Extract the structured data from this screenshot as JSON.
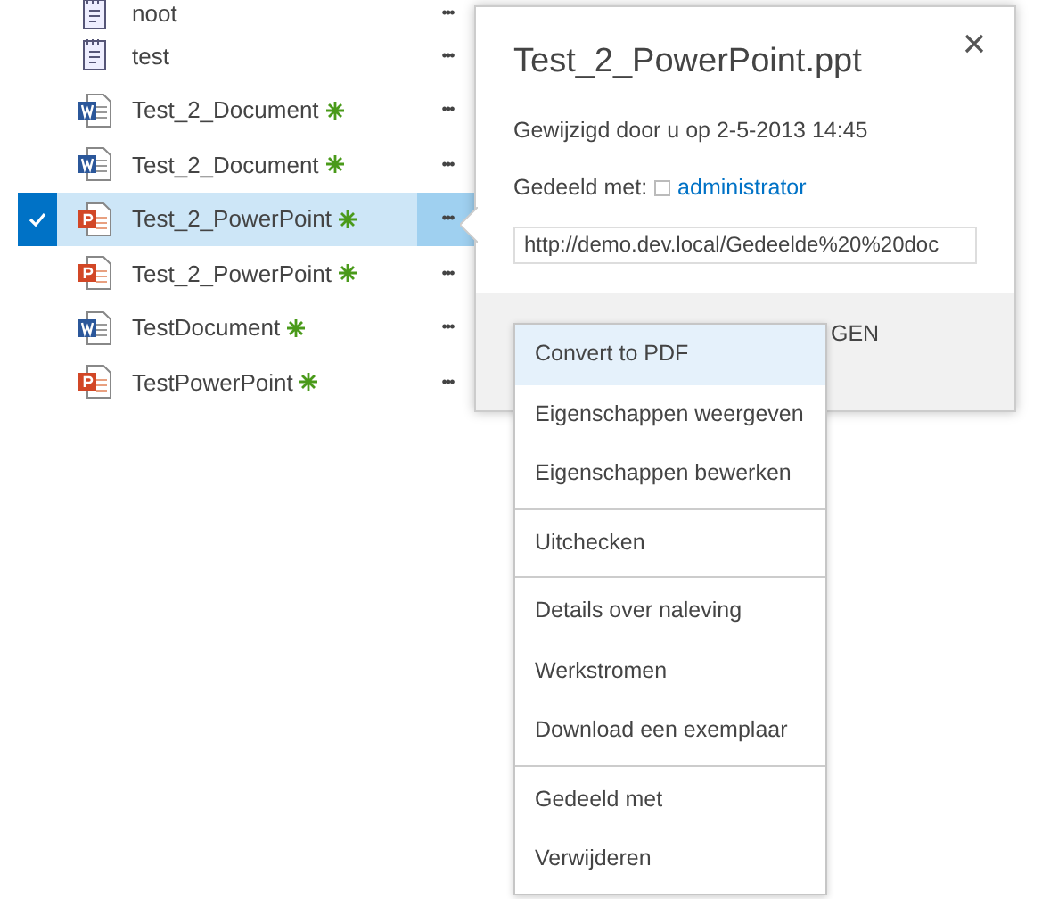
{
  "files": [
    {
      "name": "noot",
      "kind": "text",
      "new": false,
      "selected": false
    },
    {
      "name": "test",
      "kind": "text",
      "new": false,
      "selected": false
    },
    {
      "name": "Test_2_Document",
      "kind": "word",
      "new": true,
      "selected": false
    },
    {
      "name": "Test_2_Document",
      "kind": "word",
      "new": true,
      "selected": false
    },
    {
      "name": "Test_2_PowerPoint",
      "kind": "powerpoint",
      "new": true,
      "selected": true
    },
    {
      "name": "Test_2_PowerPoint",
      "kind": "powerpoint",
      "new": true,
      "selected": false
    },
    {
      "name": "TestDocument",
      "kind": "word",
      "new": true,
      "selected": false
    },
    {
      "name": "TestPowerPoint",
      "kind": "powerpoint",
      "new": true,
      "selected": false
    }
  ],
  "ellipsis": "•••",
  "callout": {
    "title": "Test_2_PowerPoint.ppt",
    "modified": "Gewijzigd door u op 2-5-2013 14:45",
    "shared_label": "Gedeeld met:",
    "shared_with": "administrator",
    "url": "http://demo.dev.local/Gedeelde%20%20doc",
    "footer_action": "GEN"
  },
  "menu": {
    "groups": [
      [
        {
          "label": "Convert to PDF",
          "selected": true
        },
        {
          "label": "Eigenschappen weergeven",
          "selected": false
        },
        {
          "label": "Eigenschappen bewerken",
          "selected": false
        }
      ],
      [
        {
          "label": "Uitchecken",
          "selected": false
        }
      ],
      [
        {
          "label": "Details over naleving",
          "selected": false
        },
        {
          "label": "Werkstromen",
          "selected": false
        },
        {
          "label": "Download een exemplaar",
          "selected": false
        }
      ],
      [
        {
          "label": "Gedeeld met",
          "selected": false
        },
        {
          "label": "Verwijderen",
          "selected": false
        }
      ]
    ]
  }
}
